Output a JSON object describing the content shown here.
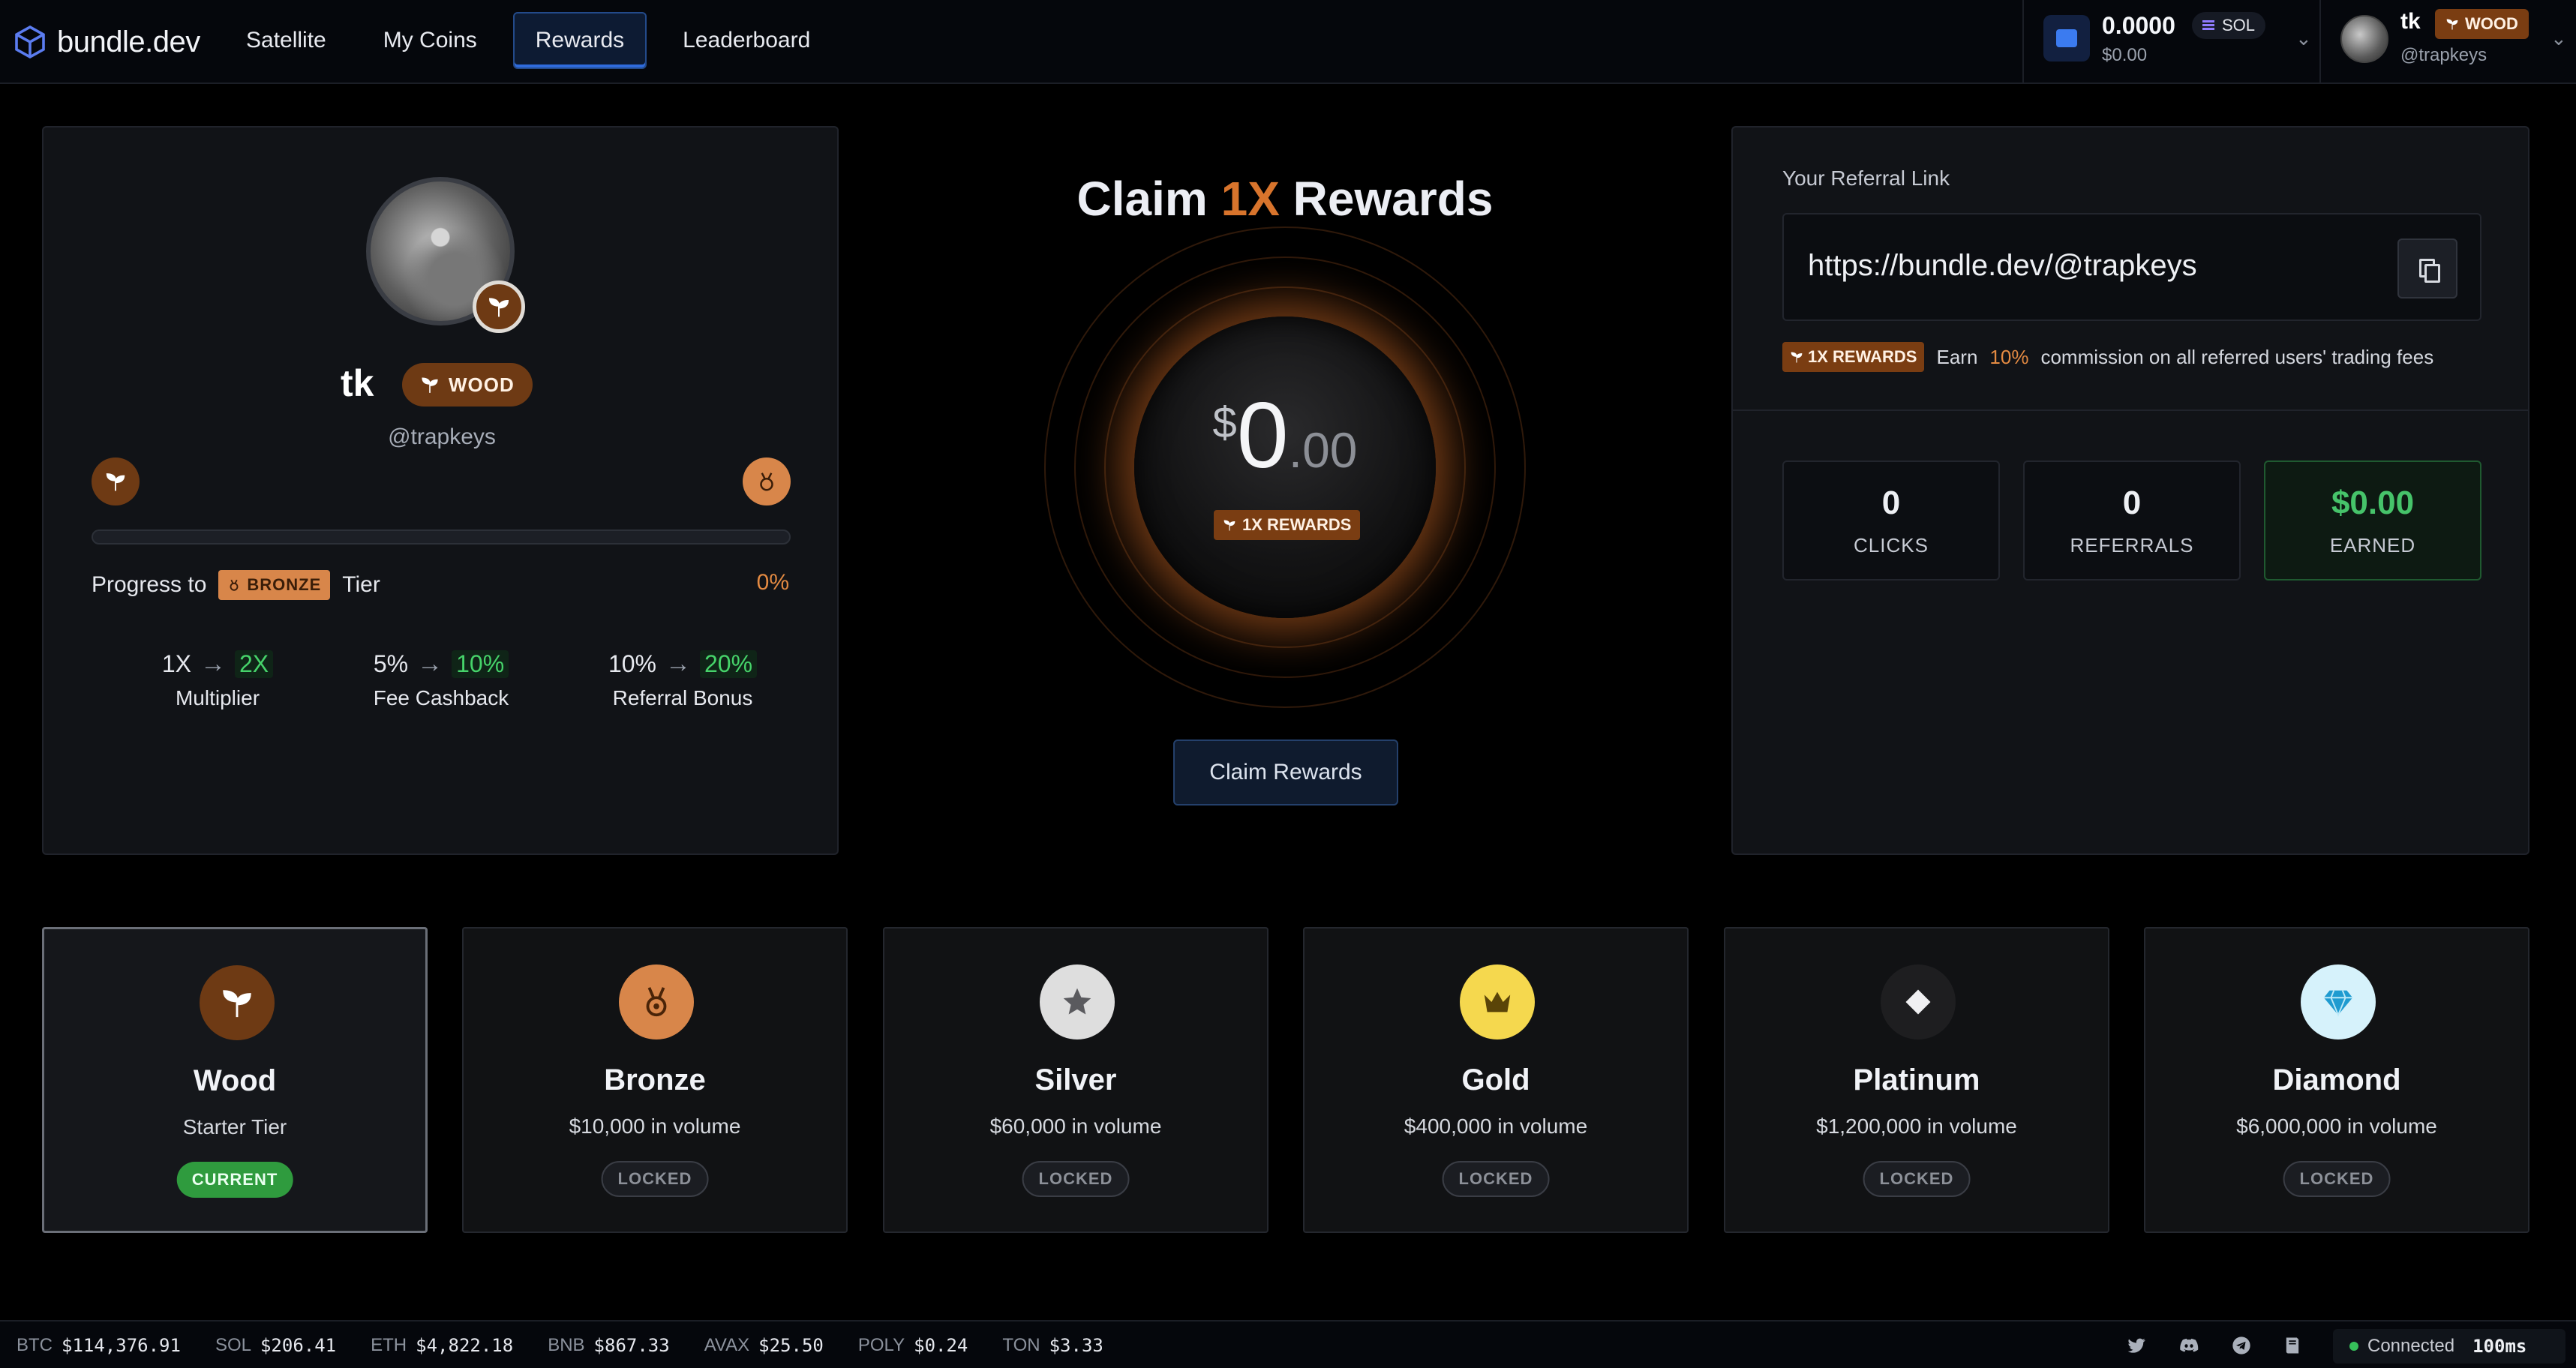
{
  "brand": {
    "name": "bundle.dev"
  },
  "nav": [
    {
      "label": "Satellite"
    },
    {
      "label": "My Coins"
    },
    {
      "label": "Rewards",
      "active": true
    },
    {
      "label": "Leaderboard"
    }
  ],
  "wallet": {
    "balance": "0.0000",
    "usd": "$0.00",
    "currency": "SOL"
  },
  "user": {
    "name": "tk",
    "handle": "@trapkeys",
    "tier": "WOOD"
  },
  "profile": {
    "name": "tk",
    "tier_badge": "WOOD",
    "handle": "@trapkeys",
    "progress_percent": 0,
    "progress_prefix": "Progress to",
    "next_tier": "BRONZE",
    "progress_suffix": "Tier",
    "progress_pct_label": "0%",
    "stats": [
      {
        "from": "1X",
        "to": "2X",
        "name": "Multiplier"
      },
      {
        "from": "5%",
        "to": "10%",
        "name": "Fee Cashback"
      },
      {
        "from": "10%",
        "to": "20%",
        "name": "Referral Bonus"
      }
    ]
  },
  "claim": {
    "title_pre": "Claim",
    "title_mult": "1X",
    "title_post": "Rewards",
    "currency": "$",
    "amount_int": "0",
    "amount_dec": ".00",
    "badge": "1X REWARDS",
    "button": "Claim Rewards"
  },
  "referral": {
    "title": "Your Referral Link",
    "url": "https://bundle.dev/@trapkeys",
    "badge": "1X REWARDS",
    "earn_pre": "Earn",
    "earn_pct": "10%",
    "earn_post": "commission on all referred users' trading fees",
    "stats": [
      {
        "value": "0",
        "label": "CLICKS"
      },
      {
        "value": "0",
        "label": "REFERRALS"
      },
      {
        "value": "$0.00",
        "label": "EARNED"
      }
    ]
  },
  "tiers": [
    {
      "name": "Wood",
      "desc": "Starter Tier",
      "status": "CURRENT",
      "icon": "sprout-icon",
      "color": "#6e3a14"
    },
    {
      "name": "Bronze",
      "desc": "$10,000 in volume",
      "status": "LOCKED",
      "icon": "medal-icon",
      "color": "#d8864a"
    },
    {
      "name": "Silver",
      "desc": "$60,000 in volume",
      "status": "LOCKED",
      "icon": "star-icon",
      "color": "#dedede"
    },
    {
      "name": "Gold",
      "desc": "$400,000 in volume",
      "status": "LOCKED",
      "icon": "crown-icon",
      "color": "#f5d84e"
    },
    {
      "name": "Platinum",
      "desc": "$1,200,000 in volume",
      "status": "LOCKED",
      "icon": "diamond-shape-icon",
      "color": "#1e1e20"
    },
    {
      "name": "Diamond",
      "desc": "$6,000,000 in volume",
      "status": "LOCKED",
      "icon": "gem-icon",
      "color": "#d6f2fb"
    }
  ],
  "ticker": [
    {
      "sym": "BTC",
      "price": "$114,376.91"
    },
    {
      "sym": "SOL",
      "price": "$206.41"
    },
    {
      "sym": "ETH",
      "price": "$4,822.18"
    },
    {
      "sym": "BNB",
      "price": "$867.33"
    },
    {
      "sym": "AVAX",
      "price": "$25.50"
    },
    {
      "sym": "POLY",
      "price": "$0.24"
    },
    {
      "sym": "TON",
      "price": "$3.33"
    }
  ],
  "status": {
    "label": "Connected",
    "latency": "100ms"
  }
}
